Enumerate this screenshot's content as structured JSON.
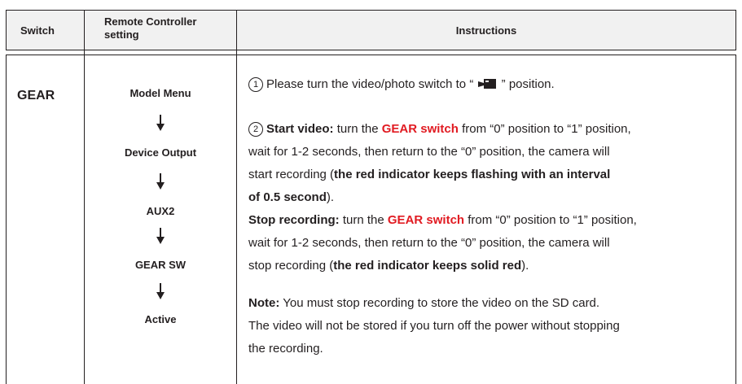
{
  "header": {
    "switch": "Switch",
    "remote_line1": "Remote Controller",
    "remote_line2": "setting",
    "instructions": "Instructions"
  },
  "row": {
    "switch": "GEAR",
    "flow": [
      "Model Menu",
      "Device Output",
      "AUX2",
      "GEAR SW",
      "Active"
    ]
  },
  "steps": {
    "s1_num": "1",
    "s1_pre": "Please turn the video/photo switch to “",
    "s1_post": "” position.",
    "s2_num": "2",
    "s2_label": "Start video:",
    "s2_a": "turn the",
    "gear_switch": "GEAR switch",
    "s2_b": "from “0” position to “1” position,",
    "s2_line2": "wait for 1-2 seconds, then return to the “0” position, the camera will",
    "s2_line3_a": "start recording (",
    "s2_line3_bold": "the red indicator keeps flashing with an interval",
    "s2_line4_bold": "of 0.5 second",
    "s2_line4_end": ").",
    "stop_label": "Stop recording:",
    "stop_a": "turn the",
    "stop_b": "from “0” position to “1” position,",
    "stop_line2": "wait for 1-2 seconds, then return to the “0” position, the camera will",
    "stop_line3_a": "stop recording (",
    "stop_line3_bold": "the red indicator keeps solid red",
    "stop_line3_end": ").",
    "note_label": "Note:",
    "note_line1": "You must stop recording to store the video on the SD card.",
    "note_line2": "The video will not be stored if you turn off the power without stopping",
    "note_line3": "the recording."
  },
  "icons": {
    "camera": "video-camera-icon",
    "arrow": "arrow-down-icon"
  },
  "colors": {
    "accent_red": "#e11b22",
    "header_bg": "#f1f1f1"
  }
}
